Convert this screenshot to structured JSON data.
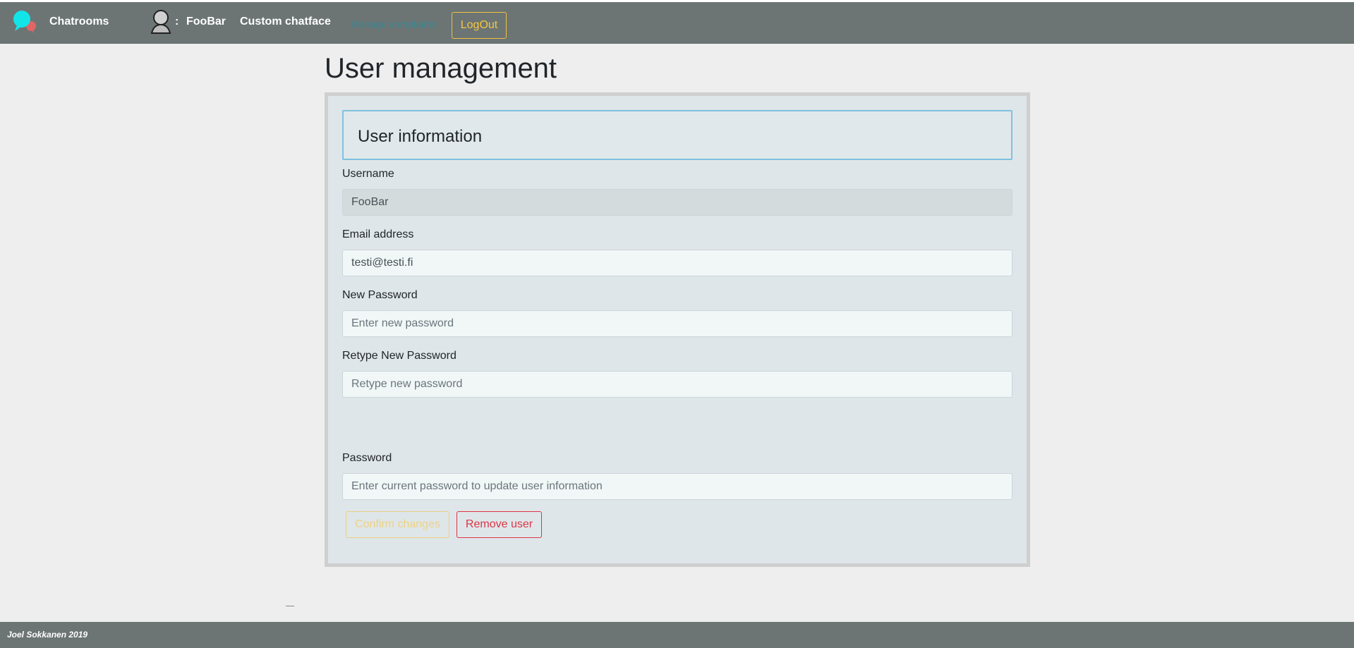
{
  "navbar": {
    "brand": "Chatrooms",
    "separator": ":",
    "username": "FooBar",
    "custom_link": "Custom chatface",
    "faded_button": "Manage complaints",
    "logout": "LogOut",
    "logo_icon": "chat-bubbles-icon",
    "avatar_icon": "user-avatar-icon",
    "colors": {
      "bg": "#6c7574",
      "logout": "#f5c542"
    }
  },
  "page": {
    "title": "User management"
  },
  "form": {
    "section_title": "User information",
    "username": {
      "label": "Username",
      "value": "FooBar"
    },
    "email": {
      "label": "Email address",
      "value": "testi@testi.fi"
    },
    "new_password": {
      "label": "New Password",
      "placeholder": "Enter new password"
    },
    "retype_password": {
      "label": "Retype New Password",
      "placeholder": "Retype new password"
    },
    "current_password": {
      "label": "Password",
      "placeholder": "Enter current password to update user information"
    },
    "confirm_button": "Confirm changes",
    "remove_button": "Remove user"
  },
  "footer": {
    "text": "Joel Sokkanen 2019"
  }
}
